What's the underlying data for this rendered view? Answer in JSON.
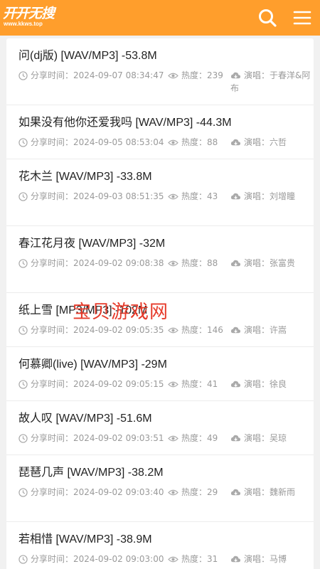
{
  "header": {
    "logo_text": "开开无搜",
    "logo_url_text": "www.kkws.top",
    "icons": {
      "search": "search-icon",
      "menu": "menu-icon"
    },
    "colors": {
      "header_bg": "#ff9e2c",
      "icon": "#ffffff"
    }
  },
  "labels": {
    "share_time": "分享时间：",
    "heat": "热度：",
    "singer": "演唱："
  },
  "songs": [
    {
      "title": "问(dj版) [WAV/MP3] -53.8M",
      "time": "2024-09-07 08:34:47",
      "heat": "239",
      "singer": "于春洋&阿布"
    },
    {
      "title": "如果没有他你还爱我吗 [WAV/MP3] -44.3M",
      "time": "2024-09-05 08:53:04",
      "heat": "88",
      "singer": "六哲"
    },
    {
      "title": "花木兰 [WAV/MP3] -33.8M",
      "time": "2024-09-03 08:51:35",
      "heat": "43",
      "singer": "刘增瞳"
    },
    {
      "title": "春江花月夜 [WAV/MP3] -32M",
      "time": "2024-09-02 09:08:38",
      "heat": "88",
      "singer": "张富贵"
    },
    {
      "title": "纸上雪 [MP3/MP3] -102M",
      "time": "2024-09-02 09:05:35",
      "heat": "146",
      "singer": "许嵩"
    },
    {
      "title": "何慕卿(live) [WAV/MP3] -29M",
      "time": "2024-09-02 09:05:15",
      "heat": "41",
      "singer": "徐良"
    },
    {
      "title": "故人叹 [WAV/MP3] -51.6M",
      "time": "2024-09-02 09:03:51",
      "heat": "49",
      "singer": "吴琼"
    },
    {
      "title": "琵琶几声 [WAV/MP3] -38.2M",
      "time": "2024-09-02 09:03:40",
      "heat": "29",
      "singer": "魏新雨"
    },
    {
      "title": "若相惜 [WAV/MP3] -38.9M",
      "time": "2024-09-02 09:03:00",
      "heat": "31",
      "singer": "马博"
    }
  ],
  "watermark": "宝贝游戏网",
  "colors": {
    "page_bg": "#f1f1f1",
    "watermark": "#e63b2b"
  }
}
